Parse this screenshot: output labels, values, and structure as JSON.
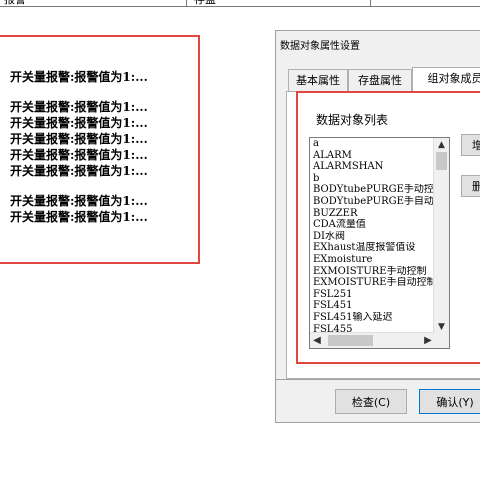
{
  "header_strip": {
    "col1": "报警",
    "col2": "存盘"
  },
  "alarm_lines": [
    "开关量报警:报警值为1:...",
    "",
    "开关量报警:报警值为1:...",
    "开关量报警:报警值为1:...",
    "开关量报警:报警值为1:...",
    "开关量报警:报警值为1:...",
    "开关量报警:报警值为1:...",
    "",
    "开关量报警:报警值为1:...",
    "开关量报警:报警值为1:..."
  ],
  "dialog": {
    "title": "数据对象属性设置",
    "tabs": [
      "基本属性",
      "存盘属性",
      "组对象成员"
    ],
    "list_label": "数据对象列表",
    "list_items": [
      "a",
      "ALARM",
      "ALARMSHAN",
      "b",
      "BODYtubePURGE手动控",
      "BODYtubePURGE手自动",
      "BUZZER",
      "CDA流量值",
      "DI水阀",
      "EXhaust温度报警值设",
      "EXmoisture",
      "EXMOISTURE手动控制",
      "EXMOISTURE手自动控制",
      "FSL251",
      "FSL451",
      "FSL451输入延迟",
      "FSL455"
    ],
    "add_button": "增加",
    "delete_button": "删除",
    "check_button": "检查(C)",
    "confirm_button": "确认(Y)"
  },
  "colors": {
    "highlight_frame": "#e0483f"
  }
}
